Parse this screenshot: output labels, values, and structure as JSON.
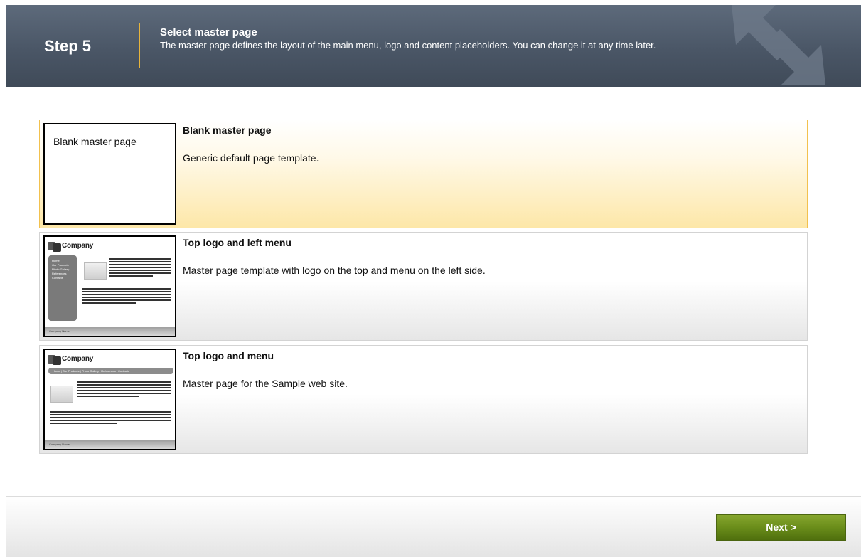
{
  "header": {
    "step": "Step 5",
    "title": "Select master page",
    "description": "The master page defines the layout of the main menu, logo and content placeholders. You can change it at any time later."
  },
  "options": [
    {
      "title": "Blank master page",
      "description": "Generic default page template.",
      "thumb_text": "Blank master page",
      "selected": true
    },
    {
      "title": "Top logo and left menu",
      "description": "Master page template with logo on the top and menu on the left side.",
      "thumb_company": "Company",
      "thumb_menu": [
        "Home",
        "Our Products",
        "Photo Gallery",
        "References",
        "Contacts"
      ],
      "thumb_footer": "Company Name",
      "selected": false
    },
    {
      "title": "Top logo and menu",
      "description": "Master page for the Sample web site.",
      "thumb_company": "Company",
      "thumb_menu_line": "Home | Our Products | Photo Gallery | References | Contacts",
      "thumb_footer": "Company Name",
      "selected": false
    }
  ],
  "footer": {
    "next_label": "Next >"
  },
  "colors": {
    "header_bg": "#4a5666",
    "divider": "#e7b43c",
    "selected_border": "#f2c14e",
    "next_button": "#6a8d1a"
  }
}
